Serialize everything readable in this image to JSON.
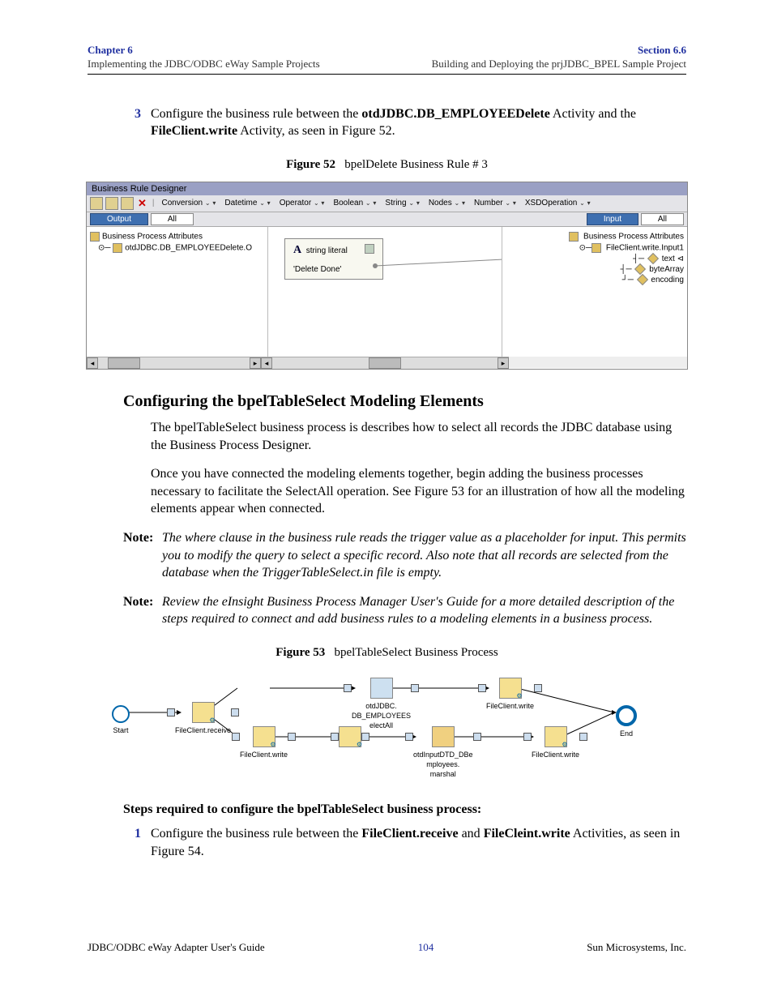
{
  "header": {
    "chapter": "Chapter 6",
    "chapter_sub": "Implementing the JDBC/ODBC eWay Sample Projects",
    "section": "Section 6.6",
    "section_sub": "Building and Deploying the prjJDBC_BPEL Sample Project"
  },
  "step3": {
    "num": "3",
    "pre": "Configure the business rule between the ",
    "b1": "otdJDBC.DB_EMPLOYEEDelete",
    "mid": " Activity and the ",
    "b2": "FileClient.write",
    "post": " Activity, as seen in Figure 52."
  },
  "figure52": {
    "caption_label": "Figure 52",
    "caption_text": "bpelDelete Business Rule # 3",
    "title": "Business Rule Designer",
    "menus": [
      "Conversion",
      "Datetime",
      "Operator",
      "Boolean",
      "String",
      "Nodes",
      "Number",
      "XSDOperation"
    ],
    "output": "Output",
    "all_l": "All",
    "input": "Input",
    "all_r": "All",
    "left_tree": {
      "root": "Business Process Attributes",
      "child": "otdJDBC.DB_EMPLOYEEDelete.O"
    },
    "method": {
      "name": "string literal",
      "value": "'Delete Done'"
    },
    "right_tree": {
      "root": "Business Process Attributes",
      "child": "FileClient.write.Input1",
      "a1": "text",
      "a2": "byteArray",
      "a3": "encoding"
    }
  },
  "heading1": "Configuring the bpelTableSelect Modeling Elements",
  "para1": "The bpelTableSelect business process is describes how to select all records the JDBC database using the Business Process Designer.",
  "para2": "Once you have connected the modeling elements together, begin adding the business processes necessary to facilitate the SelectAll operation. See Figure 53 for an illustration of how all the modeling elements appear when connected.",
  "note1": {
    "label": "Note:",
    "text": "The where clause in the business rule reads the trigger value as a placeholder for input. This permits you to modify the query to select a specific record. Also note that all records are selected from the database when the TriggerTableSelect.in file is empty."
  },
  "note2": {
    "label": "Note:",
    "text": "Review the eInsight Business Process Manager User's Guide for a more detailed description of the steps required to connect and add business rules to a modeling elements in a business process."
  },
  "figure53": {
    "caption_label": "Figure 53",
    "caption_text": "bpelTableSelect Business Process",
    "nodes": {
      "start": "Start",
      "n1": "FileClient.receive",
      "n2": "FileClient.write",
      "n3a": "otdJDBC.",
      "n3b": "DB_EMPLOYEES",
      "n3c": "electAll",
      "n4a": "otdInputDTD_DBe",
      "n4b": "mployees.",
      "n4c": "marshal",
      "n5": "FileClient.write",
      "n6": "FileClient.write",
      "end": "End"
    }
  },
  "steps_intro": "Steps required to configure the bpelTableSelect business process:",
  "step1": {
    "num": "1",
    "pre": "Configure the business rule between the ",
    "b1": "FileClient.receive",
    "mid": " and ",
    "b2": "FileCleint.write",
    "post": " Activities, as seen in Figure 54."
  },
  "footer": {
    "left": "JDBC/ODBC eWay Adapter User's Guide",
    "page": "104",
    "right": "Sun Microsystems, Inc."
  }
}
